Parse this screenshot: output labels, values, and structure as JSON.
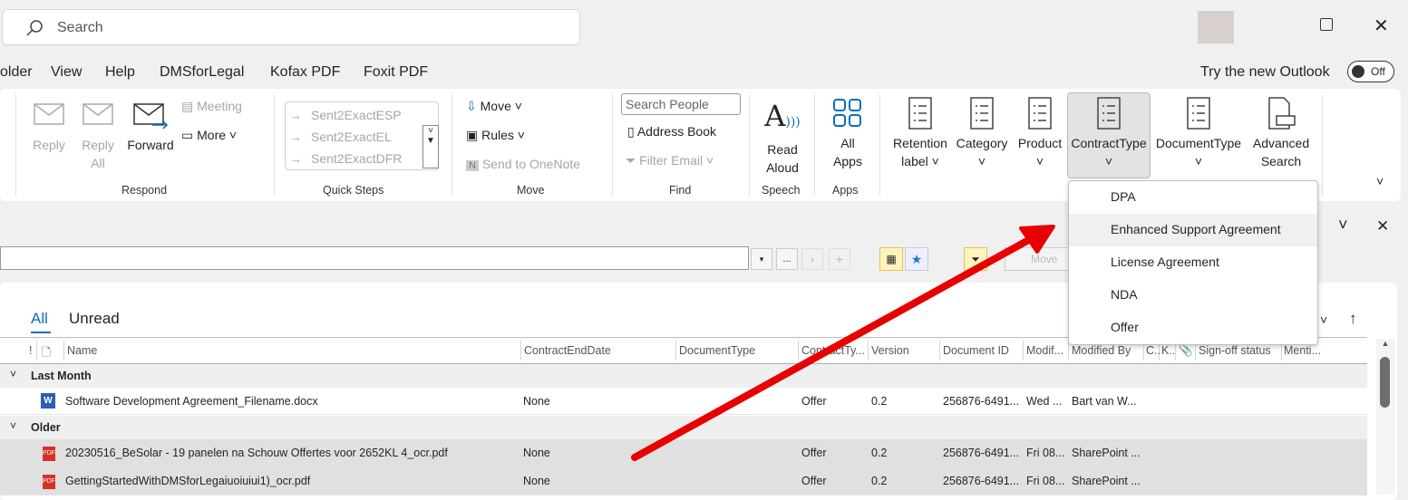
{
  "search": {
    "placeholder": "Search"
  },
  "menu": [
    "older",
    "View",
    "Help",
    "DMSforLegal",
    "Kofax PDF",
    "Foxit PDF"
  ],
  "try_new": {
    "label": "Try the new Outlook",
    "toggle": "Off"
  },
  "ribbon": {
    "respond": {
      "reply": "Reply",
      "reply_all_1": "Reply",
      "reply_all_2": "All",
      "forward": "Forward",
      "meeting": "Meeting",
      "more": "More",
      "group": "Respond"
    },
    "quick_steps": {
      "items": [
        "Sent2ExactESP",
        "Sent2ExactEL",
        "Sent2ExactDFR"
      ],
      "group": "Quick Steps"
    },
    "move": {
      "move": "Move",
      "rules": "Rules",
      "onenote": "Send to OneNote",
      "group": "Move"
    },
    "find": {
      "search_people": "Search People",
      "address_book": "Address Book",
      "filter_email": "Filter Email",
      "group": "Find"
    },
    "speech": {
      "read1": "Read",
      "read2": "Aloud",
      "group": "Speech"
    },
    "apps": {
      "all1": "All",
      "all2": "Apps",
      "group": "Apps"
    },
    "dms": [
      {
        "l1": "Retention",
        "l2": "label ˅"
      },
      {
        "l1": "Category",
        "l2": "˅"
      },
      {
        "l1": "Product",
        "l2": "˅"
      },
      {
        "l1": "ContractType",
        "l2": "˅"
      },
      {
        "l1": "DocumentType",
        "l2": "˅"
      },
      {
        "l1": "Advanced",
        "l2": "Search"
      }
    ]
  },
  "dropdown": {
    "items": [
      "DPA",
      "Enhanced Support Agreement",
      "License Agreement",
      "NDA",
      "Offer"
    ],
    "hovered": 1
  },
  "toolbar": {
    "ellipsis": "...",
    "move": "Move"
  },
  "tabs": {
    "all": "All",
    "unread": "Unread"
  },
  "columns": [
    "!",
    "Name",
    "ContractEndDate",
    "DocumentType",
    "ContractTy...",
    "Version",
    "Document ID",
    "Modif...",
    "Modified By",
    "C..",
    "K..",
    "Sign-off status",
    "Menti..."
  ],
  "groups": {
    "last_month": "Last Month",
    "older": "Older"
  },
  "rows": [
    {
      "name": "Software Development Agreement_Filename.docx",
      "type": "word",
      "end": "None",
      "ct": "Offer",
      "ver": "0.2",
      "id": "256876-6491...",
      "mod": "Wed ...",
      "by": "Bart van W..."
    },
    {
      "name": "20230516_BeSolar - 19 panelen na Schouw Offertes voor 2652KL 4_ocr.pdf",
      "type": "pdf",
      "end": "None",
      "ct": "Offer",
      "ver": "0.2",
      "id": "256876-6491...",
      "mod": "Fri 08...",
      "by": "SharePoint ..."
    },
    {
      "name": "GettingStartedWithDMSforLegaiuoiuiui1)_ocr.pdf",
      "type": "pdf",
      "end": "None",
      "ct": "Offer",
      "ver": "0.2",
      "id": "256876-6491...",
      "mod": "Fri 08...",
      "by": "SharePoint ..."
    }
  ],
  "colors": {
    "accent": "#0f6cbd",
    "arrow": "#e60000",
    "selected_row": "#e0e0e0"
  }
}
